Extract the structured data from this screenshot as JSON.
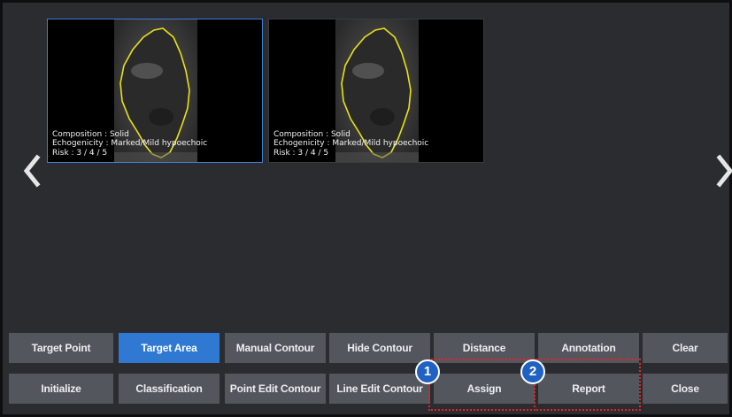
{
  "navigation": {
    "prev_icon": "chevron-left-icon",
    "next_icon": "chevron-right-icon"
  },
  "thumbnails": [
    {
      "composition": "Composition : Solid",
      "echogenicity": "Echogenicity : Marked/Mild hypoechoic",
      "risk": "Risk : 3 / 4 / 5",
      "selected": true
    },
    {
      "composition": "Composition : Solid",
      "echogenicity": "Echogenicity : Marked/Mild hypoechoic",
      "risk": "Risk : 3 / 4 / 5",
      "selected": false
    }
  ],
  "toolbar": {
    "row1": [
      "Target Point",
      "Target Area",
      "Manual Contour",
      "Hide Contour",
      "Distance",
      "Annotation",
      "Clear"
    ],
    "row2": [
      "Initialize",
      "Classification",
      "Point Edit Contour",
      "Line Edit Contour",
      "Assign",
      "Report",
      "Close"
    ],
    "active_button": "Target Area"
  },
  "callouts": [
    {
      "number": "1",
      "target": "Assign"
    },
    {
      "number": "2",
      "target": "Report"
    }
  ],
  "colors": {
    "accent": "#2f79d3",
    "button": "#53565c",
    "contour": "#e8e21a",
    "callout": "#e0262a"
  }
}
